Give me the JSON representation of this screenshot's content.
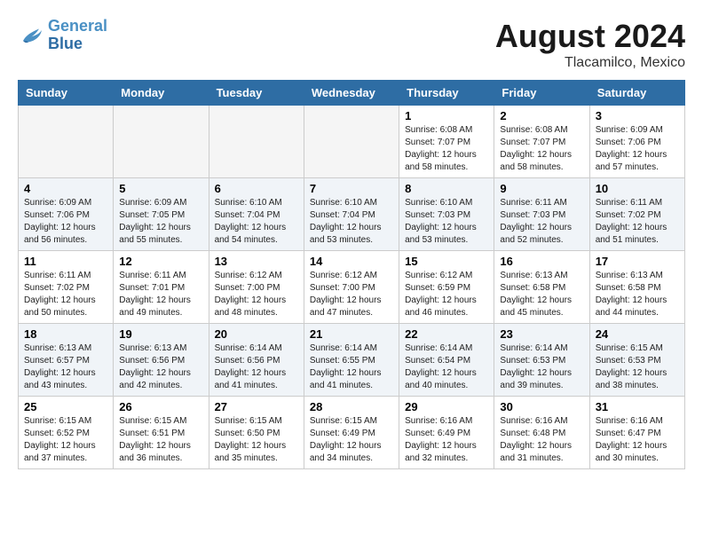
{
  "header": {
    "logo_line1": "General",
    "logo_line2": "Blue",
    "month_year": "August 2024",
    "location": "Tlacamilco, Mexico"
  },
  "days_of_week": [
    "Sunday",
    "Monday",
    "Tuesday",
    "Wednesday",
    "Thursday",
    "Friday",
    "Saturday"
  ],
  "weeks": [
    [
      {
        "day": "",
        "info": ""
      },
      {
        "day": "",
        "info": ""
      },
      {
        "day": "",
        "info": ""
      },
      {
        "day": "",
        "info": ""
      },
      {
        "day": "1",
        "info": "Sunrise: 6:08 AM\nSunset: 7:07 PM\nDaylight: 12 hours\nand 58 minutes."
      },
      {
        "day": "2",
        "info": "Sunrise: 6:08 AM\nSunset: 7:07 PM\nDaylight: 12 hours\nand 58 minutes."
      },
      {
        "day": "3",
        "info": "Sunrise: 6:09 AM\nSunset: 7:06 PM\nDaylight: 12 hours\nand 57 minutes."
      }
    ],
    [
      {
        "day": "4",
        "info": "Sunrise: 6:09 AM\nSunset: 7:06 PM\nDaylight: 12 hours\nand 56 minutes."
      },
      {
        "day": "5",
        "info": "Sunrise: 6:09 AM\nSunset: 7:05 PM\nDaylight: 12 hours\nand 55 minutes."
      },
      {
        "day": "6",
        "info": "Sunrise: 6:10 AM\nSunset: 7:04 PM\nDaylight: 12 hours\nand 54 minutes."
      },
      {
        "day": "7",
        "info": "Sunrise: 6:10 AM\nSunset: 7:04 PM\nDaylight: 12 hours\nand 53 minutes."
      },
      {
        "day": "8",
        "info": "Sunrise: 6:10 AM\nSunset: 7:03 PM\nDaylight: 12 hours\nand 53 minutes."
      },
      {
        "day": "9",
        "info": "Sunrise: 6:11 AM\nSunset: 7:03 PM\nDaylight: 12 hours\nand 52 minutes."
      },
      {
        "day": "10",
        "info": "Sunrise: 6:11 AM\nSunset: 7:02 PM\nDaylight: 12 hours\nand 51 minutes."
      }
    ],
    [
      {
        "day": "11",
        "info": "Sunrise: 6:11 AM\nSunset: 7:02 PM\nDaylight: 12 hours\nand 50 minutes."
      },
      {
        "day": "12",
        "info": "Sunrise: 6:11 AM\nSunset: 7:01 PM\nDaylight: 12 hours\nand 49 minutes."
      },
      {
        "day": "13",
        "info": "Sunrise: 6:12 AM\nSunset: 7:00 PM\nDaylight: 12 hours\nand 48 minutes."
      },
      {
        "day": "14",
        "info": "Sunrise: 6:12 AM\nSunset: 7:00 PM\nDaylight: 12 hours\nand 47 minutes."
      },
      {
        "day": "15",
        "info": "Sunrise: 6:12 AM\nSunset: 6:59 PM\nDaylight: 12 hours\nand 46 minutes."
      },
      {
        "day": "16",
        "info": "Sunrise: 6:13 AM\nSunset: 6:58 PM\nDaylight: 12 hours\nand 45 minutes."
      },
      {
        "day": "17",
        "info": "Sunrise: 6:13 AM\nSunset: 6:58 PM\nDaylight: 12 hours\nand 44 minutes."
      }
    ],
    [
      {
        "day": "18",
        "info": "Sunrise: 6:13 AM\nSunset: 6:57 PM\nDaylight: 12 hours\nand 43 minutes."
      },
      {
        "day": "19",
        "info": "Sunrise: 6:13 AM\nSunset: 6:56 PM\nDaylight: 12 hours\nand 42 minutes."
      },
      {
        "day": "20",
        "info": "Sunrise: 6:14 AM\nSunset: 6:56 PM\nDaylight: 12 hours\nand 41 minutes."
      },
      {
        "day": "21",
        "info": "Sunrise: 6:14 AM\nSunset: 6:55 PM\nDaylight: 12 hours\nand 41 minutes."
      },
      {
        "day": "22",
        "info": "Sunrise: 6:14 AM\nSunset: 6:54 PM\nDaylight: 12 hours\nand 40 minutes."
      },
      {
        "day": "23",
        "info": "Sunrise: 6:14 AM\nSunset: 6:53 PM\nDaylight: 12 hours\nand 39 minutes."
      },
      {
        "day": "24",
        "info": "Sunrise: 6:15 AM\nSunset: 6:53 PM\nDaylight: 12 hours\nand 38 minutes."
      }
    ],
    [
      {
        "day": "25",
        "info": "Sunrise: 6:15 AM\nSunset: 6:52 PM\nDaylight: 12 hours\nand 37 minutes."
      },
      {
        "day": "26",
        "info": "Sunrise: 6:15 AM\nSunset: 6:51 PM\nDaylight: 12 hours\nand 36 minutes."
      },
      {
        "day": "27",
        "info": "Sunrise: 6:15 AM\nSunset: 6:50 PM\nDaylight: 12 hours\nand 35 minutes."
      },
      {
        "day": "28",
        "info": "Sunrise: 6:15 AM\nSunset: 6:49 PM\nDaylight: 12 hours\nand 34 minutes."
      },
      {
        "day": "29",
        "info": "Sunrise: 6:16 AM\nSunset: 6:49 PM\nDaylight: 12 hours\nand 32 minutes."
      },
      {
        "day": "30",
        "info": "Sunrise: 6:16 AM\nSunset: 6:48 PM\nDaylight: 12 hours\nand 31 minutes."
      },
      {
        "day": "31",
        "info": "Sunrise: 6:16 AM\nSunset: 6:47 PM\nDaylight: 12 hours\nand 30 minutes."
      }
    ]
  ]
}
